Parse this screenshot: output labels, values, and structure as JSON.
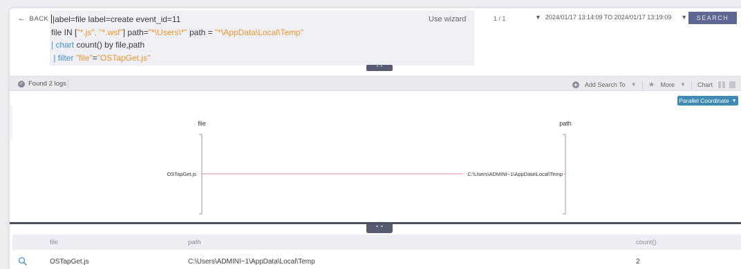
{
  "topbar": {
    "back_label": "BACK",
    "query_lines": [
      [
        "|abel=file label=create event_id=11"
      ],
      [
        "file IN [",
        "\"*.js\", \"*.wsf\"",
        "] path=",
        "\"*\\Users\\*\"",
        " path = ",
        "\"*\\AppData\\Local\\Temp\""
      ],
      [
        "| chart ",
        "count() by file,path"
      ],
      [
        " | filter ",
        "\"file\"",
        "=",
        "\"OSTapGet.js\""
      ]
    ],
    "use_wizard": "Use wizard",
    "pager": "1 / 1",
    "date_range": "2024/01/17 13:14:09 TO 2024/01/17 13:19:09",
    "search_label": "SEARCH"
  },
  "status": {
    "found": "Found 2 logs",
    "add_search_to": "Add Search To",
    "more": "More",
    "chart": "Chart"
  },
  "chart_data": {
    "type": "parallel-coordinates",
    "axes": [
      "file",
      "path"
    ],
    "lines": [
      {
        "file": "OSTapGet.js",
        "path": "C:\\Users\\ADMINI~1\\AppData\\Local\\Temp"
      }
    ],
    "line_color": "#e98aa4",
    "view_selector": "Parallel Coordinate"
  },
  "table": {
    "columns": [
      "file",
      "path",
      "count()"
    ],
    "rows": [
      {
        "file": "OSTapGet.js",
        "path": "C:\\Users\\ADMINI~1\\AppData\\Local\\Temp",
        "count": "2"
      }
    ]
  },
  "colors": {
    "accent": "#5e6792",
    "string": "#e8962f",
    "pipe": "#4a90c8",
    "pc_button": "#3f8ab4"
  }
}
